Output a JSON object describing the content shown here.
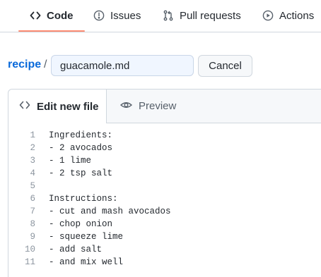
{
  "repo_nav": {
    "tabs": [
      {
        "label": "Code",
        "icon": "code-icon",
        "active": true
      },
      {
        "label": "Issues",
        "icon": "issue-opened-icon",
        "active": false
      },
      {
        "label": "Pull requests",
        "icon": "git-pull-request-icon",
        "active": false
      },
      {
        "label": "Actions",
        "icon": "play-icon",
        "active": false
      }
    ],
    "active_underline_color": "#fd8c73"
  },
  "path": {
    "repo_name": "recipe",
    "separator": "/",
    "filename_value": "guacamole.md",
    "cancel_label": "Cancel"
  },
  "editor": {
    "tabs": [
      {
        "label": "Edit new file",
        "icon": "code-icon",
        "active": true
      },
      {
        "label": "Preview",
        "icon": "eye-icon",
        "active": false
      }
    ],
    "lines": [
      {
        "n": "1",
        "text": "Ingredients:"
      },
      {
        "n": "2",
        "text": "- 2 avocados"
      },
      {
        "n": "3",
        "text": "- 1 lime"
      },
      {
        "n": "4",
        "text": "- 2 tsp salt"
      },
      {
        "n": "5",
        "text": ""
      },
      {
        "n": "6",
        "text": "Instructions:"
      },
      {
        "n": "7",
        "text": "- cut and mash avocados"
      },
      {
        "n": "8",
        "text": "- chop onion"
      },
      {
        "n": "9",
        "text": "- squeeze lime"
      },
      {
        "n": "10",
        "text": "- add salt"
      },
      {
        "n": "11",
        "text": "- and mix well"
      }
    ]
  },
  "colors": {
    "link": "#0969da",
    "border": "#d0d7de",
    "input_focus_bg": "#f0f6ff"
  }
}
